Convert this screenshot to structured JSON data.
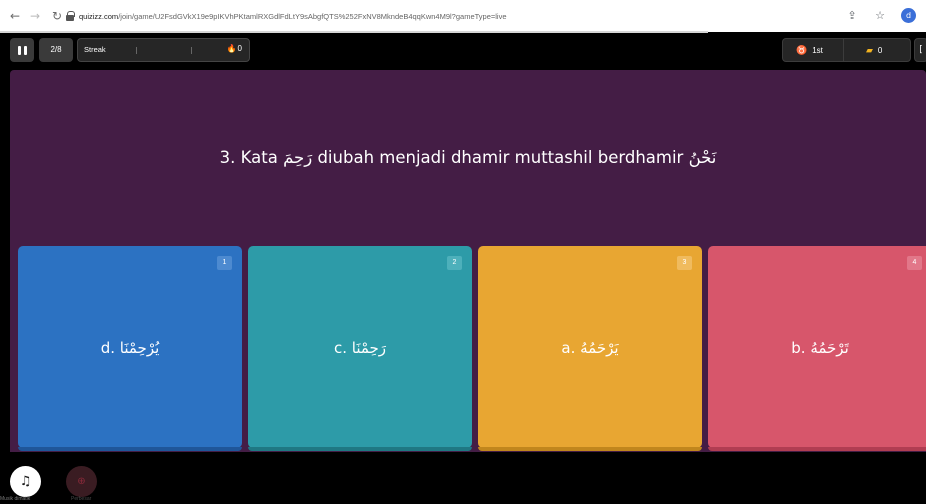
{
  "browser": {
    "url_host": "quizizz.com",
    "url_path": "/join/game/U2FsdGVkX19e9pIKVhPKtamlRXGdlFdLtY9sAbgfQTS%252FxNV8MkndeB4qqKwn4M9l?gameType=live",
    "profile_initial": "d"
  },
  "topbar": {
    "question_counter": "2/8",
    "streak_label": "Streak",
    "streak_count": "0",
    "rank": "1st",
    "coins": "0"
  },
  "question": {
    "text": "3. Kata رَحِمَ diubah menjadi dhamir muttashil berdhamir نَحْنُ"
  },
  "options": [
    {
      "num": "1",
      "text": "d. يُرْحِمْنَا",
      "color": "#2c72c2"
    },
    {
      "num": "2",
      "text": "c. رَحِمْنَا",
      "color": "#2d9ba8"
    },
    {
      "num": "3",
      "text": "a. يَرْحَمُهُ",
      "color": "#e8a632"
    },
    {
      "num": "4",
      "text": "b. تَرْحَمُهُ",
      "color": "#d7566b"
    }
  ],
  "bottom": {
    "music_label": "Musik dimatik",
    "zoom_label": "Perbesar"
  },
  "colors": {
    "question_bg": "#441d45"
  }
}
